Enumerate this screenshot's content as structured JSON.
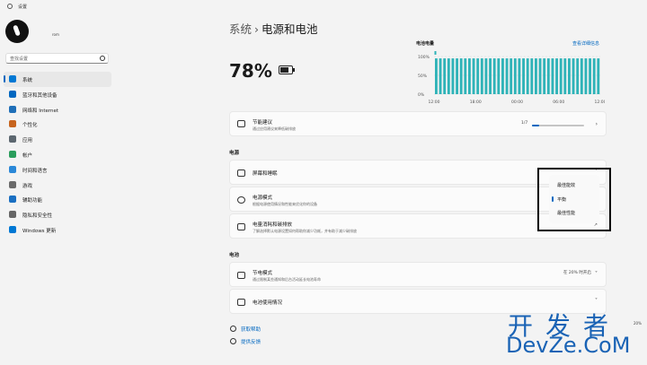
{
  "window": {
    "title": "设置"
  },
  "user": {
    "email": "rom"
  },
  "search": {
    "placeholder": "查找设置"
  },
  "sidebar": {
    "items": [
      {
        "label": "系统",
        "icon": "monitor-icon",
        "color": "#0078d4",
        "active": true
      },
      {
        "label": "蓝牙和其他设备",
        "icon": "bluetooth-icon",
        "color": "#0067c0"
      },
      {
        "label": "网络和 Internet",
        "icon": "wifi-icon",
        "color": "#1f6fb8"
      },
      {
        "label": "个性化",
        "icon": "brush-icon",
        "color": "#c7641e"
      },
      {
        "label": "应用",
        "icon": "apps-icon",
        "color": "#5c6770"
      },
      {
        "label": "帐户",
        "icon": "account-icon",
        "color": "#2a9d5c"
      },
      {
        "label": "时间和语言",
        "icon": "globe-icon",
        "color": "#2b88d8"
      },
      {
        "label": "游戏",
        "icon": "gamepad-icon",
        "color": "#6b6b6b"
      },
      {
        "label": "辅助功能",
        "icon": "accessibility-icon",
        "color": "#1a6fc2"
      },
      {
        "label": "隐私和安全性",
        "icon": "shield-icon",
        "color": "#666666"
      },
      {
        "label": "Windows 更新",
        "icon": "update-icon",
        "color": "#0078d4"
      }
    ]
  },
  "breadcrumb": {
    "parent": "系统",
    "separator": "›",
    "current": "电源和电池"
  },
  "battery": {
    "percent": "78%"
  },
  "chart": {
    "title": "电池电量",
    "link": "查看详细信息",
    "y_labels": [
      "100%",
      "50%",
      "0%"
    ],
    "x_labels": [
      "12:00",
      "18:00",
      "00:00",
      "06:00",
      "12:00"
    ]
  },
  "chart_data": {
    "type": "bar",
    "title": "电池电量",
    "x": [
      "12:00",
      "18:00",
      "00:00",
      "06:00",
      "12:00"
    ],
    "values": [
      95,
      95,
      95,
      95,
      95,
      95,
      95,
      95,
      95,
      95,
      95,
      95,
      95,
      95,
      95,
      95,
      95,
      95,
      95,
      95,
      95,
      95,
      95,
      95,
      95,
      95,
      95,
      95,
      95,
      95,
      95,
      95,
      95,
      95,
      95,
      95,
      95,
      95,
      95,
      95
    ],
    "yticks": [
      "0%",
      "50%",
      "100%"
    ],
    "ylim": [
      0,
      100
    ],
    "color": "#2fb3b8"
  },
  "energy_recommendations": {
    "title": "节能建议",
    "subtitle": "通过应用建议来降低碳排放",
    "progress_text": "1/7",
    "progress_fraction": 0.14
  },
  "power_section": {
    "header": "电源",
    "screen_sleep": {
      "title": "屏幕和睡眠"
    },
    "power_mode": {
      "title": "电源模式",
      "subtitle": "根据电源使用情况和性能来优化你的设备",
      "options": [
        "最佳能效",
        "平衡",
        "最佳性能"
      ],
      "selected": "平衡"
    },
    "energy_recs2": {
      "title": "电量消耗和碳排放",
      "subtitle": "了解选择默认电源设置如何帮助你减少功耗，并有助于减少碳排放"
    }
  },
  "battery_section": {
    "header": "电池",
    "saver": {
      "title": "节电模式",
      "subtitle": "通过限制某些通知和后台活动延长电池寿命",
      "value": "在 20% 时开启"
    },
    "usage": {
      "title": "电池使用情况"
    }
  },
  "links": {
    "help": "获取帮助",
    "feedback": "提供反馈"
  },
  "watermark": {
    "line1": "开发者",
    "line2": "DevZe.CoM",
    "fragment": "20%"
  }
}
